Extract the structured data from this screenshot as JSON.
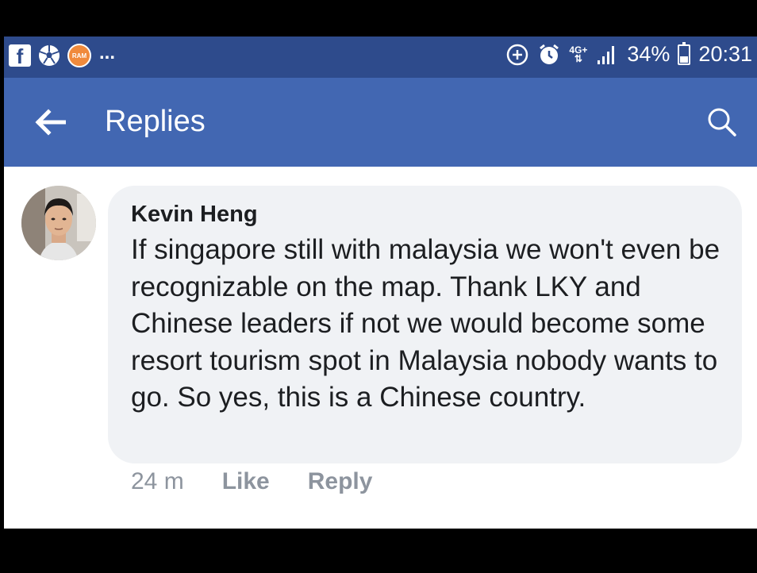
{
  "status_bar": {
    "left_icons": [
      "facebook-icon",
      "soccer-ball-icon",
      "ram-icon"
    ],
    "ram_badge": "RAM",
    "more_indicator": "...",
    "network": "4G+",
    "battery_percent": "34%",
    "battery_level": 0.34,
    "time": "20:31"
  },
  "app_bar": {
    "title": "Replies",
    "background": "#4267b2",
    "back_icon": "arrow-left-icon",
    "search_icon": "search-icon"
  },
  "comment": {
    "author": "Kevin Heng",
    "text": "If singapore still with malaysia we won't even be recognizable on the map. Thank LKY and Chinese leaders if not we would become some resort tourism spot in Malaysia nobody wants to go. So yes, this is a Chinese country.",
    "timestamp": "24 m",
    "like_label": "Like",
    "reply_label": "Reply"
  }
}
